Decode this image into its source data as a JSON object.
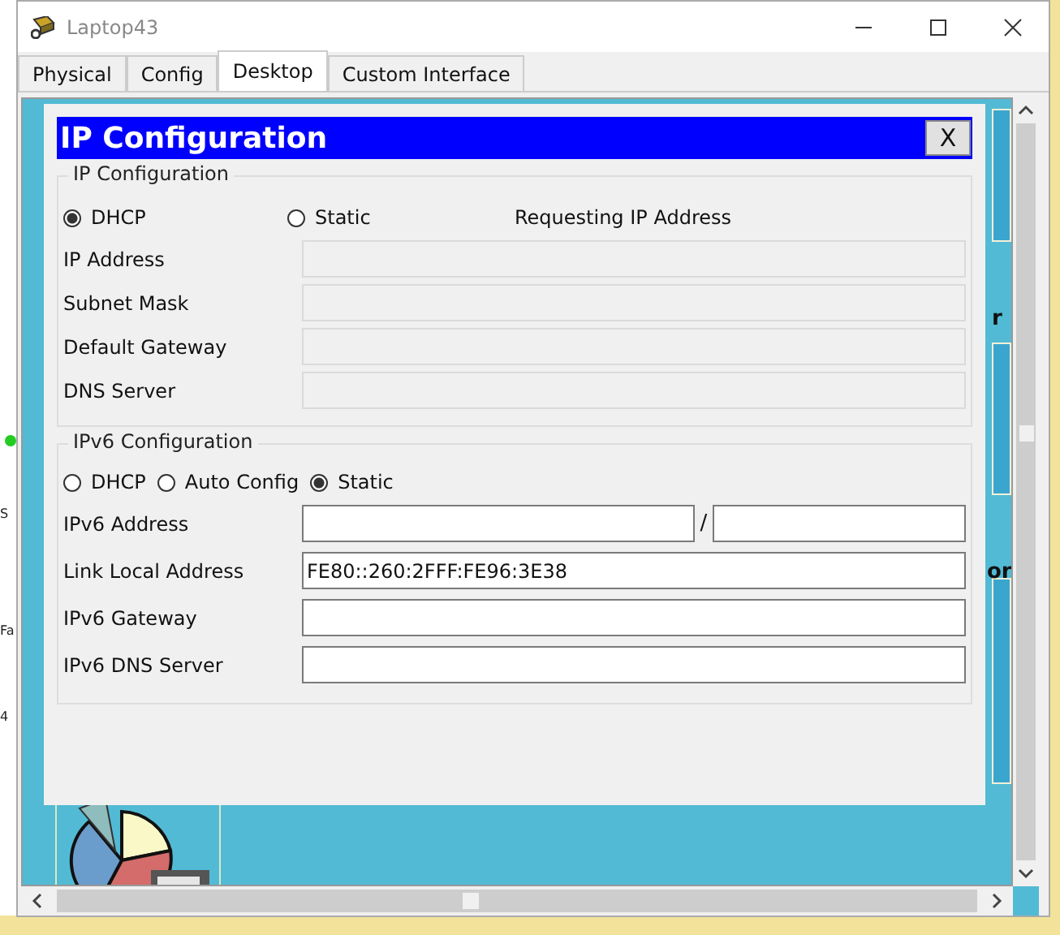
{
  "window": {
    "title": "Laptop43"
  },
  "tabs": [
    {
      "label": "Physical",
      "selected": false
    },
    {
      "label": "Config",
      "selected": false
    },
    {
      "label": "Desktop",
      "selected": true
    },
    {
      "label": "Custom Interface",
      "selected": false
    }
  ],
  "background_fragments": [
    "S",
    "Fa",
    "4"
  ],
  "desktop_label_fragments": [
    "r",
    "or"
  ],
  "dialog": {
    "title": "IP Configuration",
    "close_label": "X",
    "ipv4": {
      "legend": "IP Configuration",
      "status": "Requesting IP Address",
      "modes": [
        {
          "label": "DHCP",
          "selected": true
        },
        {
          "label": "Static",
          "selected": false
        }
      ],
      "fields": [
        {
          "label": "IP Address",
          "disabled": true
        },
        {
          "label": "Subnet Mask",
          "disabled": true
        },
        {
          "label": "Default Gateway",
          "disabled": true
        },
        {
          "label": "DNS Server",
          "disabled": true
        }
      ]
    },
    "ipv6": {
      "legend": "IPv6 Configuration",
      "prefix_separator": "/",
      "modes": [
        {
          "label": "DHCP",
          "selected": false
        },
        {
          "label": "Auto Config",
          "selected": false
        },
        {
          "label": "Static",
          "selected": true
        }
      ],
      "fields": [
        {
          "label": "IPv6 Address",
          "kind": "address_prefix",
          "disabled": false
        },
        {
          "label": "Link Local Address",
          "kind": "plain",
          "value": "FE80::260:2FFF:FE96:3E38",
          "disabled": false
        },
        {
          "label": "IPv6 Gateway",
          "kind": "plain",
          "disabled": false
        },
        {
          "label": "IPv6 DNS Server",
          "kind": "plain",
          "disabled": false
        }
      ]
    }
  }
}
